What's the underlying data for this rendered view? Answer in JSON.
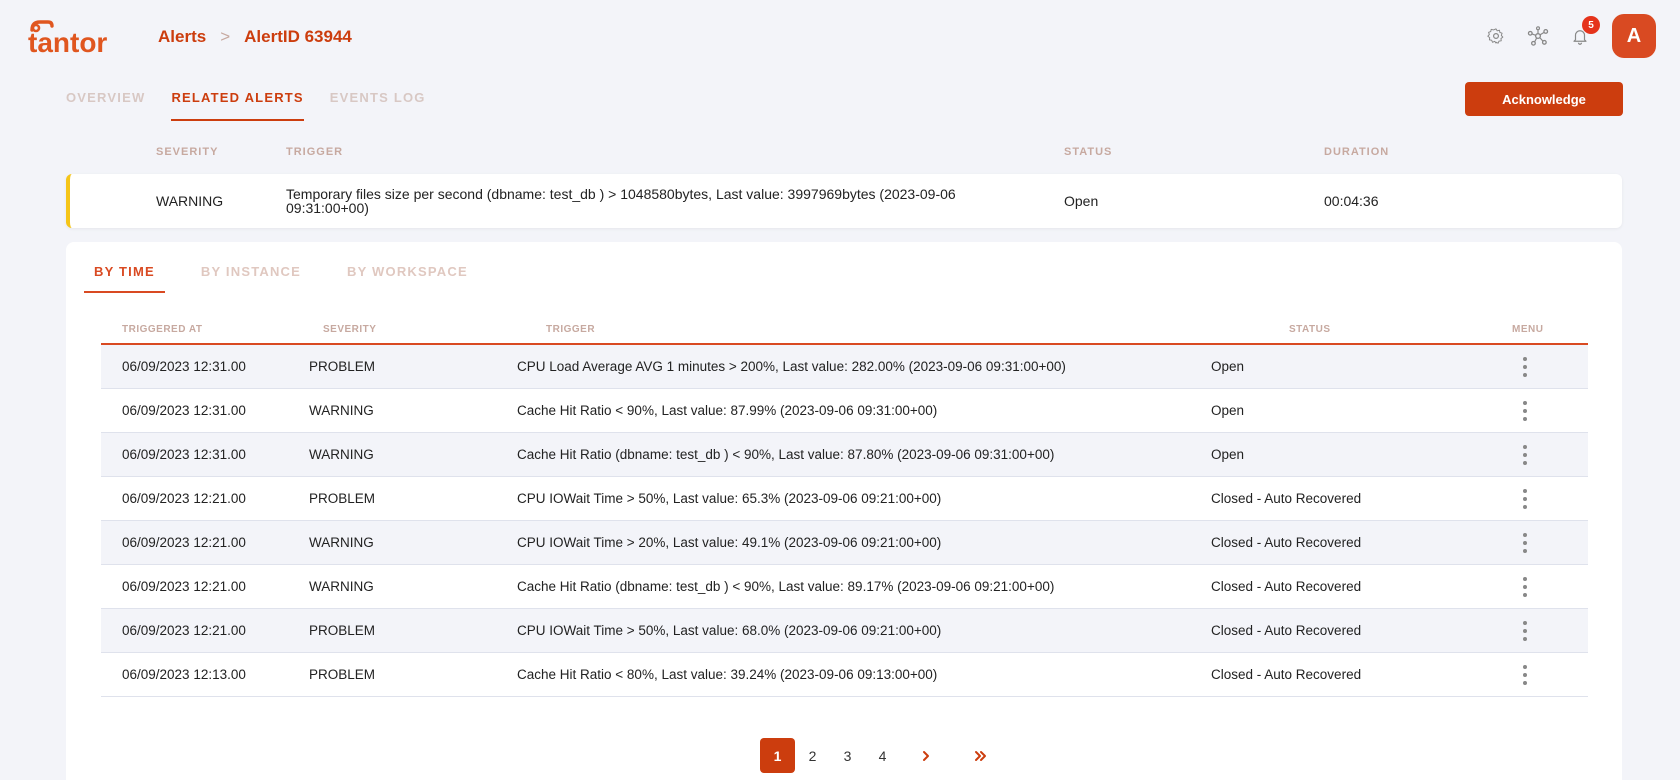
{
  "header": {
    "logo_text": "tantor",
    "breadcrumb": {
      "parent": "Alerts",
      "separator": ">",
      "current": "AlertID 63944"
    },
    "notifications_count": "5",
    "avatar_letter": "A"
  },
  "top_tabs": [
    "OVERVIEW",
    "RELATED ALERTS",
    "EVENTS LOG"
  ],
  "acknowledge_label": "Acknowledge",
  "summary": {
    "headers": {
      "severity": "SEVERITY",
      "trigger": "TRIGGER",
      "status": "STATUS",
      "duration": "DURATION"
    },
    "severity": "WARNING",
    "trigger_line1": "Temporary files size per second (dbname: test_db ) > 1048580bytes, Last value: 3997969bytes (2023-09-06",
    "trigger_line2": "09:31:00+00)",
    "status": "Open",
    "duration": "00:04:36"
  },
  "sub_tabs": [
    "BY TIME",
    "BY INSTANCE",
    "BY WORKSPACE"
  ],
  "table": {
    "headers": {
      "triggered_at": "TRIGGERED AT",
      "severity": "SEVERITY",
      "trigger": "TRIGGER",
      "status": "STATUS",
      "menu": "MENU"
    },
    "rows": [
      {
        "triggered_at": "06/09/2023 12:31.00",
        "severity": "PROBLEM",
        "trigger": "CPU Load Average AVG 1 minutes > 200%, Last value: 282.00% (2023-09-06 09:31:00+00)",
        "status": "Open"
      },
      {
        "triggered_at": "06/09/2023 12:31.00",
        "severity": "WARNING",
        "trigger": "Cache Hit Ratio < 90%, Last value: 87.99% (2023-09-06 09:31:00+00)",
        "status": "Open"
      },
      {
        "triggered_at": "06/09/2023 12:31.00",
        "severity": "WARNING",
        "trigger": "Cache Hit Ratio (dbname: test_db ) < 90%, Last value: 87.80% (2023-09-06 09:31:00+00)",
        "status": "Open"
      },
      {
        "triggered_at": "06/09/2023 12:21.00",
        "severity": "PROBLEM",
        "trigger": "CPU IOWait Time > 50%, Last value: 65.3% (2023-09-06 09:21:00+00)",
        "status": "Closed - Auto Recovered"
      },
      {
        "triggered_at": "06/09/2023 12:21.00",
        "severity": "WARNING",
        "trigger": "CPU IOWait Time > 20%, Last value: 49.1% (2023-09-06 09:21:00+00)",
        "status": "Closed - Auto Recovered"
      },
      {
        "triggered_at": "06/09/2023 12:21.00",
        "severity": "WARNING",
        "trigger": "Cache Hit Ratio (dbname: test_db ) < 90%, Last value: 89.17% (2023-09-06 09:21:00+00)",
        "status": "Closed - Auto Recovered"
      },
      {
        "triggered_at": "06/09/2023 12:21.00",
        "severity": "PROBLEM",
        "trigger": "CPU IOWait Time > 50%, Last value: 68.0% (2023-09-06 09:21:00+00)",
        "status": "Closed - Auto Recovered"
      },
      {
        "triggered_at": "06/09/2023 12:13.00",
        "severity": "PROBLEM",
        "trigger": "Cache Hit Ratio < 80%, Last value: 39.24% (2023-09-06 09:13:00+00)",
        "status": "Closed - Auto Recovered"
      }
    ]
  },
  "pagination": {
    "pages": [
      "1",
      "2",
      "3",
      "4"
    ],
    "current": "1",
    "next": "›",
    "last": "»"
  },
  "colors": {
    "accent": "#cc3d0e",
    "warning_bar": "#f5c518",
    "badge": "#e5331c"
  }
}
